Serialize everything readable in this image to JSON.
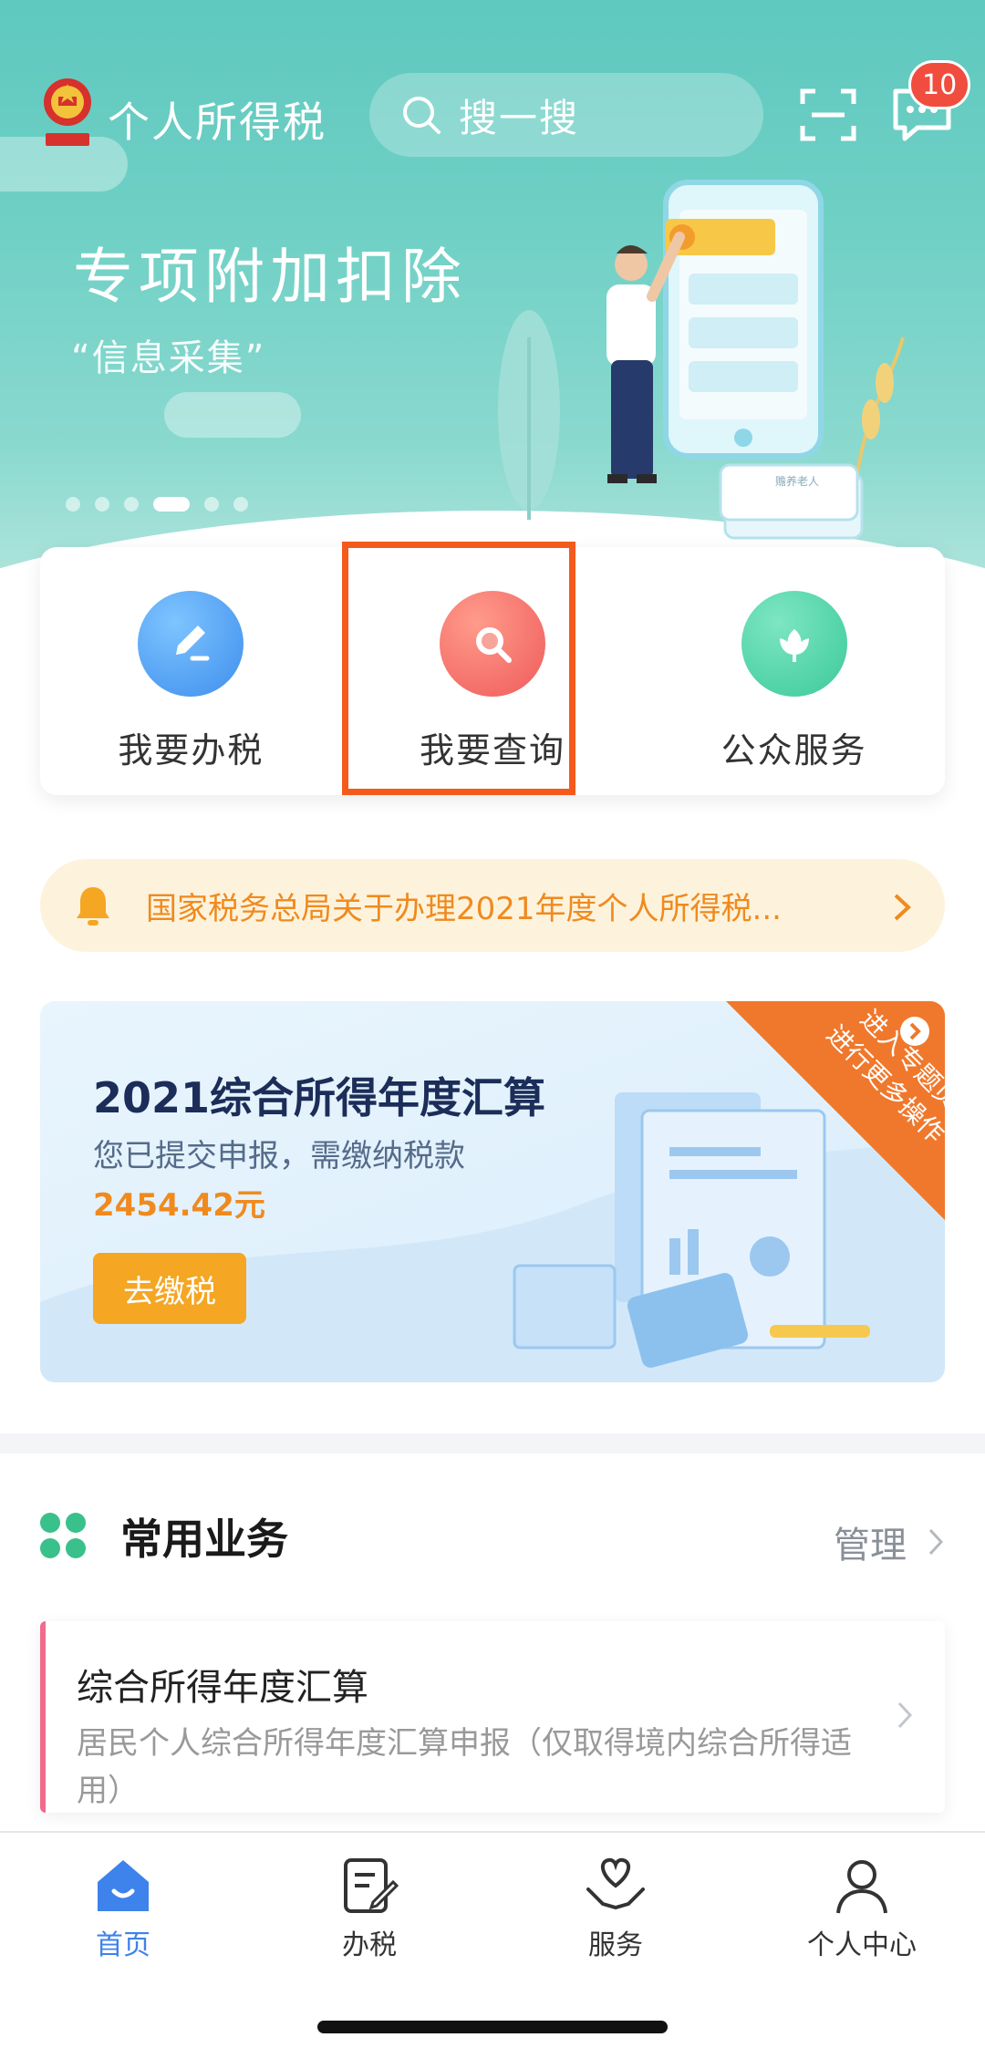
{
  "header": {
    "app_title": "个人所得税",
    "search_label": "搜一搜",
    "message_badge": "10"
  },
  "banner": {
    "title": "专项附加扣除",
    "subtitle": "“信息采集”",
    "illustration_card_text": "赡养老人",
    "slide_count": 6,
    "active_slide": 4
  },
  "quick_actions": [
    {
      "label": "我要办税",
      "icon": "edit-icon",
      "color": "#3e8eed"
    },
    {
      "label": "我要查询",
      "icon": "search-icon",
      "color": "#ef5b5b",
      "highlighted": true
    },
    {
      "label": "公众服务",
      "icon": "lotus-icon",
      "color": "#3cc99a"
    }
  ],
  "notice": {
    "text": "国家税务总局关于办理2021年度个人所得税..."
  },
  "annual_card": {
    "title": "2021综合所得年度汇算",
    "subtitle": "您已提交申报，需缴纳税款",
    "amount": "2454.42元",
    "button_label": "去缴税",
    "ribbon_line1": "进入专题页",
    "ribbon_line2": "进行更多操作"
  },
  "common_services": {
    "title": "常用业务",
    "manage_label": "管理",
    "items": [
      {
        "title": "综合所得年度汇算",
        "description": "居民个人综合所得年度汇算申报（仅取得境内综合所得适用）"
      }
    ]
  },
  "bottom_nav": [
    {
      "label": "首页",
      "icon": "home-icon",
      "active": true
    },
    {
      "label": "办税",
      "icon": "tax-form-icon",
      "active": false
    },
    {
      "label": "服务",
      "icon": "heart-hand-icon",
      "active": false
    },
    {
      "label": "个人中心",
      "icon": "user-icon",
      "active": false
    }
  ],
  "colors": {
    "hero_teal": "#5fc8bf",
    "accent_blue": "#3e82ec",
    "highlight_orange": "#f45a1c",
    "amount_orange": "#f08a1e",
    "pay_button": "#f5a623"
  }
}
